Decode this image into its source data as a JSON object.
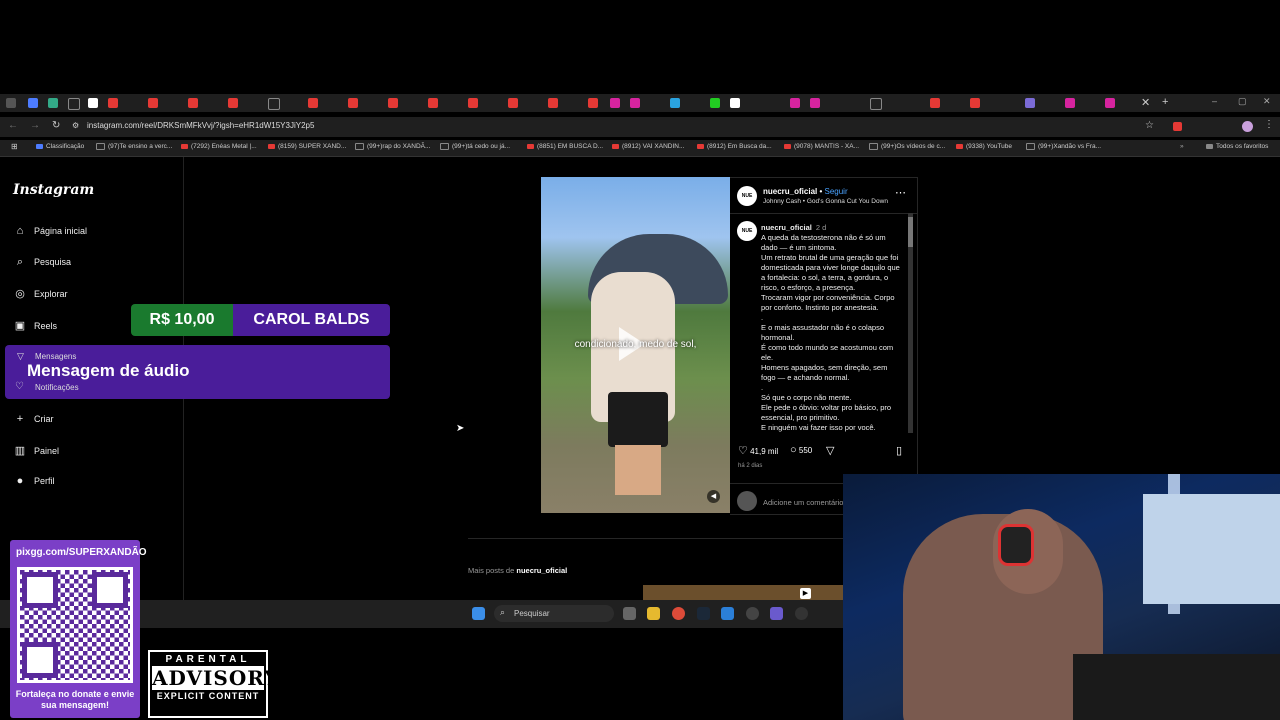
{
  "browser": {
    "url": "instagram.com/reel/DRKSmMFkVvj/?igsh=eHR1dW15Y3JiY2p5",
    "bookmarks": [
      "Classificação",
      "(97)Te ensino a verc...",
      "(7292) Enéas Metal |...",
      "(8159) SUPER XAND...",
      "(99+)rap do XANDÃ...",
      "(99+)tá cedo ou já...",
      "(8851) EM BUSCA D...",
      "(8912) VAI XANDIN...",
      "(8912) Em Busca da...",
      "(9078) MANTIS - XA...",
      "(99+)Os vídeos de c...",
      "(9338) YouTube",
      "(99+)Xandão vs Fra..."
    ],
    "all_favorites": "Todos os favoritos"
  },
  "sidebar": {
    "logo": "Instagram",
    "items": [
      {
        "label": "Página inicial",
        "icon": "home-icon"
      },
      {
        "label": "Pesquisa",
        "icon": "search-icon"
      },
      {
        "label": "Explorar",
        "icon": "compass-icon"
      },
      {
        "label": "Reels",
        "icon": "reels-icon"
      },
      {
        "label": "Mensagens",
        "icon": "messenger-icon"
      },
      {
        "label": "Notificações",
        "icon": "heart-icon"
      },
      {
        "label": "Criar",
        "icon": "plus-icon"
      },
      {
        "label": "Painel",
        "icon": "dashboard-icon"
      },
      {
        "label": "Perfil",
        "icon": "profile-icon"
      }
    ]
  },
  "donation": {
    "amount": "R$ 10,00",
    "name": "CAROL BALDS",
    "message": "Mensagem de áudio"
  },
  "post": {
    "video_caption": "condicionado, medo de sol,",
    "username": "nuecru_oficial",
    "follow": "Seguir",
    "music": "Johnny Cash • God's Gonna Cut You Down",
    "caption_time": "2 d",
    "caption_lines": [
      "A queda da testosterona não é só um dado — é um sintoma.",
      "Um retrato brutal de uma geração que foi domesticada para viver longe daquilo que a fortalecia: o sol, a terra, a gordura, o risco, o esforço, a presença.",
      "Trocaram vigor por conveniência. Corpo por conforto. Instinto por anestesia.",
      ".",
      "E o mais assustador não é o colapso hormonal.",
      "É como todo mundo se acostumou com ele.",
      "Homens apagados, sem direção, sem fogo — e achando normal.",
      ".",
      "Só que o corpo não mente.",
      "Ele pede o óbvio: voltar pro básico, pro essencial, pro primitivo.",
      "E ninguém vai fazer isso por você."
    ],
    "likes": "41,9 mil",
    "comments": "550",
    "posted": "há 2 dias",
    "comment_placeholder": "Adicione um comentário...",
    "more_posts_prefix": "Mais posts de",
    "more_posts_user": "nuecru_oficial"
  },
  "taskbar": {
    "search": "Pesquisar"
  },
  "overlay": {
    "qr_url": "pixgg.com/SUPERXANDÃO",
    "qr_text": "Fortaleça no donate e envie sua mensagem!",
    "advisory_top": "PARENTAL",
    "advisory_mid": "ADVISORY",
    "advisory_bottom": "EXPLICIT CONTENT"
  },
  "colors": {
    "accent": "#4aa3ff",
    "donation_green": "#1a7a2e",
    "donation_purple": "#4a1d9a"
  }
}
